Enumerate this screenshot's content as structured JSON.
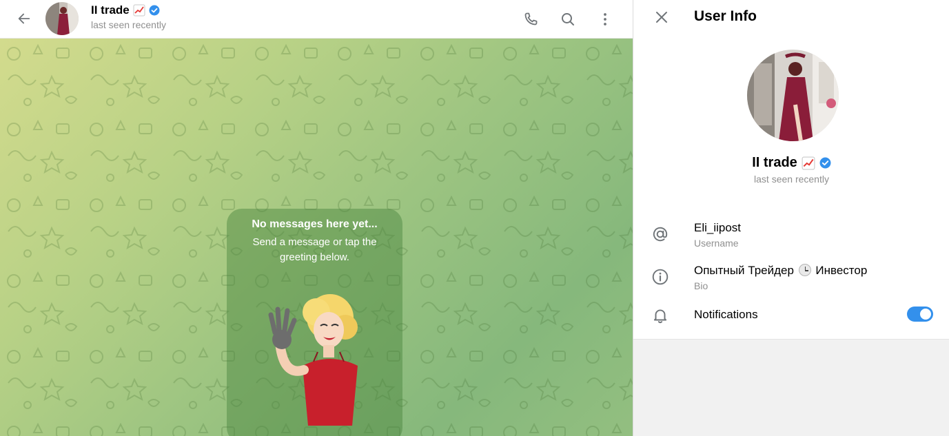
{
  "chat": {
    "title": "II trade",
    "status": "last seen recently",
    "verified": true,
    "empty": {
      "title": "No messages here yet...",
      "subtitle": "Send a message or tap the greeting below."
    }
  },
  "header_icons": [
    "back-arrow-icon",
    "phone-icon",
    "search-icon",
    "more-vertical-icon"
  ],
  "info_panel": {
    "title": "User Info",
    "name": "II trade",
    "status": "last seen recently",
    "username": "Eli_iipost",
    "username_label": "Username",
    "bio_before": "Опытный Трейдер",
    "bio_after": "Инвестор",
    "bio_label": "Bio",
    "notifications_label": "Notifications",
    "notifications_enabled": true
  },
  "colors": {
    "accent": "#3390ec",
    "muted_text": "#8f8f8f",
    "chat_gradient_start": "#d3db8d",
    "chat_gradient_end": "#86b87c"
  }
}
